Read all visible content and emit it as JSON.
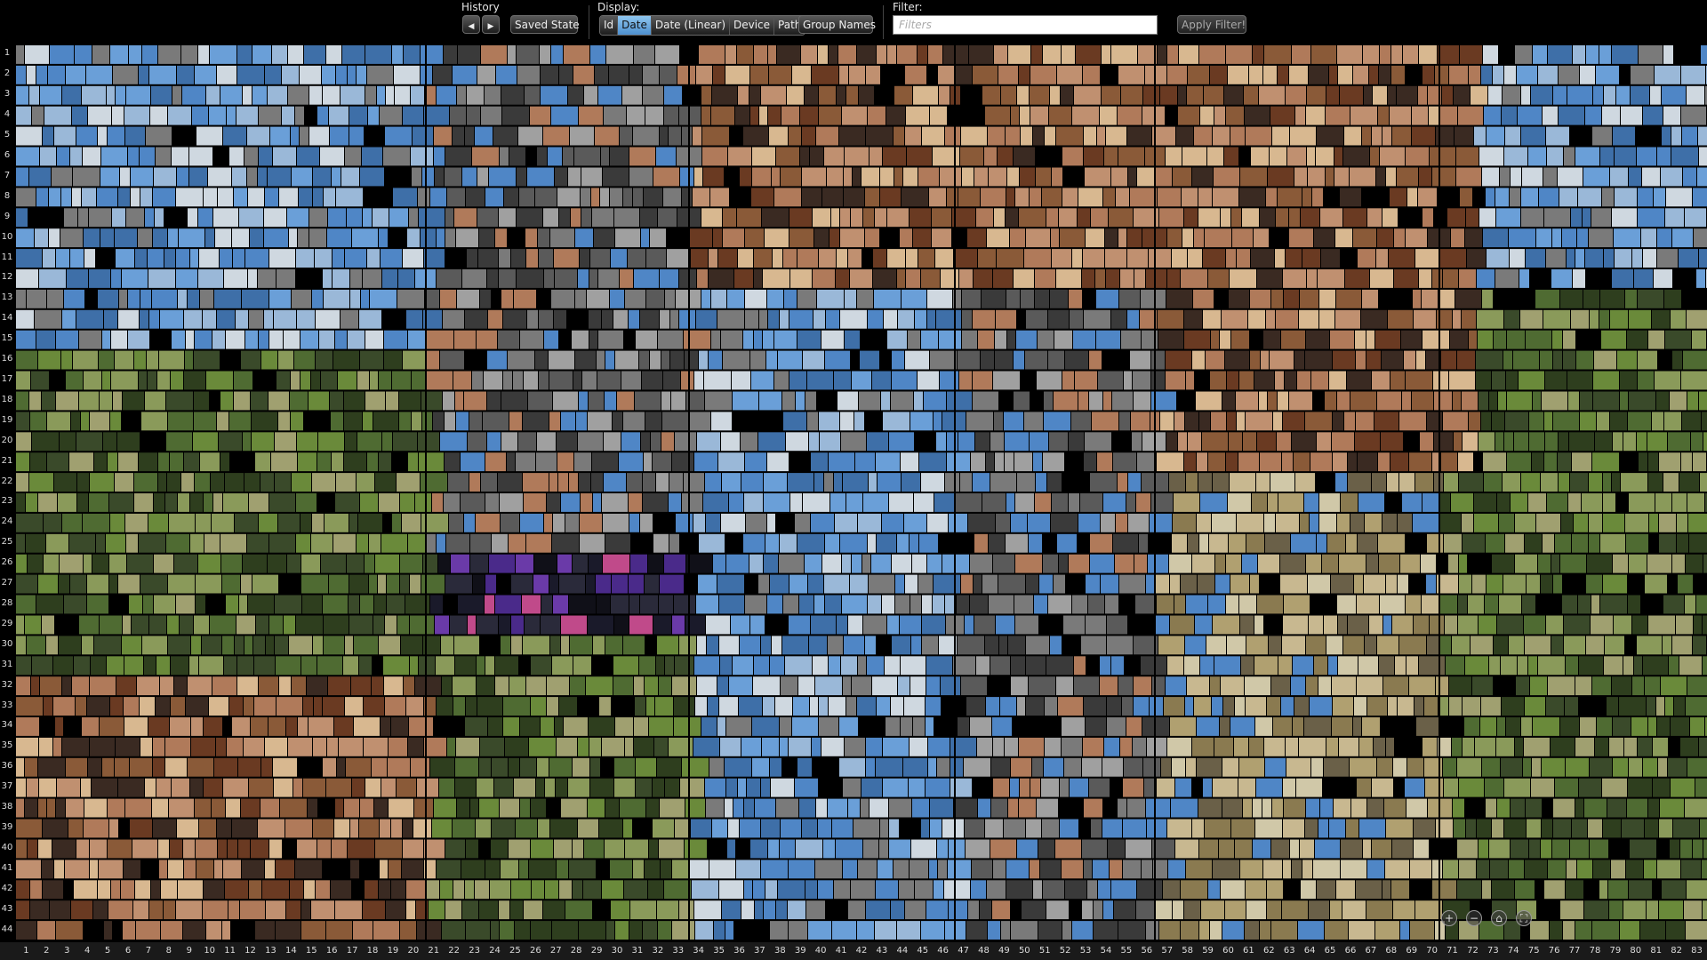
{
  "toolbar": {
    "history_label": "History",
    "back_glyph": "◀",
    "forward_glyph": "▶",
    "saved_state_label": "Saved State",
    "display_label": "Display:",
    "display_options": [
      "Id",
      "Date",
      "Date (Linear)",
      "Device",
      "Path"
    ],
    "display_selected": "Date",
    "group_names_label": "Group Names",
    "filter_label": "Filter:",
    "filter_placeholder": "Filters",
    "filter_value": "",
    "apply_filter_label": "Apply Filter!"
  },
  "grid": {
    "row_count": 44,
    "column_count": 83,
    "row_labels": [
      "1",
      "2",
      "3",
      "4",
      "5",
      "6",
      "7",
      "8",
      "9",
      "10",
      "11",
      "12",
      "13",
      "14",
      "15",
      "16",
      "17",
      "18",
      "19",
      "20",
      "21",
      "22",
      "23",
      "24",
      "25",
      "26",
      "27",
      "28",
      "29",
      "30",
      "31",
      "32",
      "33",
      "34",
      "35",
      "36",
      "37",
      "38",
      "39",
      "40",
      "41",
      "42",
      "43",
      "44"
    ],
    "column_labels": [
      "1",
      "2",
      "3",
      "4",
      "5",
      "6",
      "7",
      "8",
      "9",
      "10",
      "11",
      "12",
      "13",
      "14",
      "15",
      "16",
      "17",
      "18",
      "19",
      "20",
      "21",
      "22",
      "23",
      "24",
      "25",
      "26",
      "27",
      "28",
      "29",
      "30",
      "31",
      "32",
      "33",
      "34",
      "35",
      "36",
      "37",
      "38",
      "39",
      "40",
      "41",
      "42",
      "43",
      "44",
      "45",
      "46",
      "47",
      "48",
      "49",
      "50",
      "51",
      "52",
      "53",
      "54",
      "55",
      "56",
      "57",
      "58",
      "59",
      "60",
      "61",
      "62",
      "63",
      "64",
      "65",
      "66",
      "67",
      "68",
      "69",
      "70",
      "71",
      "72",
      "73",
      "74",
      "75",
      "76",
      "77",
      "78",
      "79",
      "80",
      "81",
      "82",
      "83"
    ]
  },
  "zoom_controls": {
    "zoom_in_glyph": "+",
    "zoom_out_glyph": "−",
    "home_glyph": "⌂",
    "fullscreen_glyph": "⛶"
  },
  "colors": {
    "accent_selected": "#6eaee6",
    "background": "#000000",
    "sky": "#4f86c6",
    "warm": "#8a5a38",
    "skin": "#b07a5a",
    "green": "#4f6b32",
    "night": "#1a1a2a",
    "purple": "#4a2a8a",
    "grey": "#7a7a7a"
  }
}
